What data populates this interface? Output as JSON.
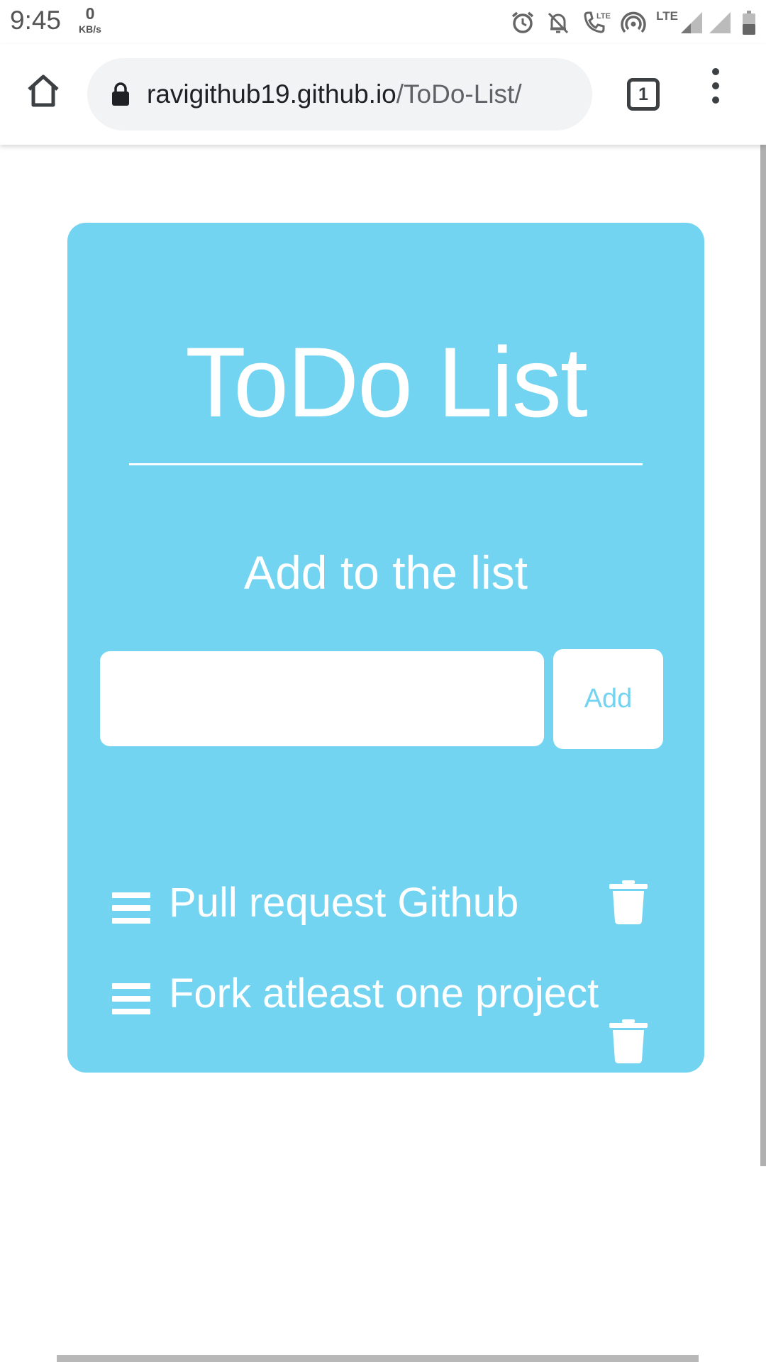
{
  "status_bar": {
    "time": "9:45",
    "net_speed_value": "0",
    "net_speed_unit": "KB/s",
    "lte_label_1": "LTE",
    "lte_label_2": "LTE",
    "icons": [
      "alarm-icon",
      "notifications-off-icon",
      "volte-call-icon",
      "hotspot-icon",
      "signal-icon",
      "signal-icon",
      "battery-icon"
    ]
  },
  "browser": {
    "url_domain": "ravigithub19.github.io",
    "url_path": "/ToDo-List/",
    "tab_count": "1",
    "icons": [
      "home-icon",
      "lock-icon",
      "tabs-icon",
      "more-vert-icon"
    ]
  },
  "app": {
    "title": "ToDo List",
    "subtitle": "Add to the list",
    "input_value": "",
    "add_label": "Add",
    "items": [
      {
        "text": "Pull request Github"
      },
      {
        "text": "Fork atleast one project"
      }
    ]
  },
  "colors": {
    "card_background": "#72d4f1",
    "accent_text": "#72d4f1",
    "foreground": "#ffffff"
  }
}
